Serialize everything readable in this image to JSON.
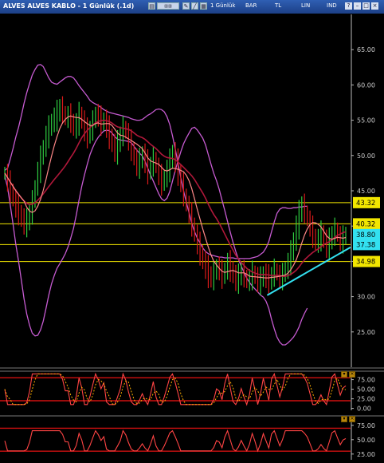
{
  "window": {
    "title": "ALVES ALVES KABLO - 1 Günlük (.1d)",
    "toolbar": {
      "period_label": "1 Günlük",
      "chart_type_label": "BAR",
      "currency_label": "TL",
      "scale_label": "LIN",
      "indicator_label": "IND"
    }
  },
  "colors": {
    "background": "#000000",
    "up_bar": "#2ecc40",
    "down_bar": "#d91a1a",
    "bollinger": "#c65bd1",
    "ma_short": "#ff8888",
    "ma_long": "#b0183a",
    "trendline": "#33e0f0",
    "level_line": "#f2e600",
    "axis_text": "#cccccc",
    "osc_line": "#ff4444",
    "osc_signal": "#ffb000",
    "osc_band": "#d01010"
  },
  "chart_data": [
    {
      "type": "bar",
      "panel": "price",
      "ylim": [
        20,
        70
      ],
      "y_ticks": [
        25.0,
        30.0,
        35.0,
        40.0,
        45.0,
        50.0,
        55.0,
        60.0,
        65.0
      ],
      "y_tick_labels": [
        "25.00",
        "30.00",
        "35.00",
        "40.00",
        "45.00",
        "50.00",
        "55.00",
        "60.00",
        "65.00"
      ],
      "level_labels": [
        {
          "value": 43.32,
          "text": "43.32",
          "style": "yellow"
        },
        {
          "value": 40.32,
          "text": "40.32",
          "style": "yellow"
        },
        {
          "value": 38.8,
          "text": "38.80",
          "style": "cyan"
        },
        {
          "value": 37.38,
          "text": "37.38",
          "style": "cyan"
        },
        {
          "value": 34.98,
          "text": "34.98",
          "style": "yellow"
        }
      ],
      "horizontal_lines": [
        43.32,
        40.32,
        37.38,
        34.98
      ],
      "trendline": {
        "from": [
          0.76,
          30.2
        ],
        "to": [
          1.0,
          37.0
        ]
      },
      "series_close": [
        47.5,
        46.2,
        45.0,
        43.8,
        42.6,
        41.9,
        41.0,
        40.3,
        40.6,
        41.8,
        43.5,
        45.6,
        47.8,
        49.7,
        51.2,
        52.8,
        53.9,
        54.8,
        55.3,
        56.0,
        56.8,
        56.1,
        55.2,
        55.7,
        54.9,
        53.8,
        54.6,
        55.8,
        54.9,
        53.5,
        52.9,
        53.7,
        54.8,
        56.0,
        55.4,
        54.5,
        55.1,
        53.9,
        52.7,
        51.6,
        50.6,
        51.7,
        52.9,
        54.0,
        53.3,
        52.0,
        50.9,
        49.6,
        48.5,
        49.3,
        50.2,
        49.0,
        47.8,
        48.6,
        49.6,
        48.4,
        47.1,
        46.0,
        46.9,
        48.0,
        49.2,
        50.4,
        49.1,
        47.6,
        46.0,
        44.4,
        43.0,
        41.7,
        40.2,
        38.8,
        37.4,
        36.2,
        35.0,
        34.0,
        33.1,
        32.5,
        33.3,
        34.4,
        33.6,
        32.8,
        33.8,
        34.8,
        33.9,
        33.0,
        32.3,
        32.8,
        33.6,
        32.9,
        32.1,
        32.6,
        33.4,
        32.8,
        32.0,
        32.5,
        33.2,
        32.7,
        32.2,
        33.0,
        33.8,
        33.2,
        32.6,
        33.1,
        33.9,
        34.8,
        36.2,
        38.0,
        40.0,
        41.8,
        43.0,
        42.0,
        40.9,
        39.8,
        38.6,
        37.6,
        38.2,
        39.0,
        38.0,
        37.0,
        37.9,
        38.8,
        39.6,
        38.7,
        37.8,
        38.4,
        38.9
      ],
      "series_upper_band": [
        47.9,
        48.2,
        49.5,
        51.0,
        52.6,
        54.0,
        55.6,
        57.4,
        58.9,
        60.2,
        61.4,
        62.2,
        62.8,
        62.9,
        62.6,
        61.8,
        61.0,
        60.4,
        60.2,
        60.1,
        60.4,
        60.7,
        61.0,
        61.2,
        61.2,
        61.0,
        60.5,
        59.9,
        59.4,
        58.9,
        58.4,
        57.8,
        57.5,
        57.3,
        57.1,
        56.8,
        56.5,
        56.3,
        56.1,
        56.0,
        55.9,
        55.8,
        55.7,
        55.6,
        55.5,
        55.4,
        55.2,
        55.1,
        55.0,
        55.0,
        55.1,
        55.4,
        55.7,
        55.9,
        56.2,
        56.5,
        56.6,
        56.5,
        56.2,
        55.5,
        54.4,
        52.8,
        50.9,
        48.9,
        46.9,
        45.0,
        43.4,
        41.9,
        40.4,
        39.2,
        38.3,
        37.6,
        36.9,
        36.4,
        36.1,
        35.9,
        35.8,
        35.7,
        35.6,
        35.6,
        35.5,
        35.5,
        35.5,
        35.5,
        35.4,
        35.4,
        35.4,
        35.4,
        35.4,
        35.4,
        35.5,
        35.6,
        35.7,
        36.0,
        36.3,
        36.9,
        37.8,
        39.2,
        40.6,
        41.8,
        42.4,
        42.6,
        42.6,
        42.5,
        42.5,
        42.6,
        42.6,
        42.7,
        42.7,
        42.8,
        42.8
      ]
    },
    {
      "type": "line",
      "panel": "oscillator_1",
      "ylim": [
        -5,
        95
      ],
      "y_tick_labels": [
        "75.00",
        "50.00",
        "25.00",
        "0.00"
      ],
      "y_ticks": [
        75,
        50,
        25,
        0
      ],
      "bands": [
        80,
        20
      ]
    },
    {
      "type": "line",
      "panel": "oscillator_2",
      "ylim": [
        15,
        90
      ],
      "y_tick_labels": [
        "75.00",
        "50.00",
        "25.00"
      ],
      "y_ticks": [
        75,
        50,
        25
      ],
      "bands": [
        70,
        30
      ]
    }
  ]
}
